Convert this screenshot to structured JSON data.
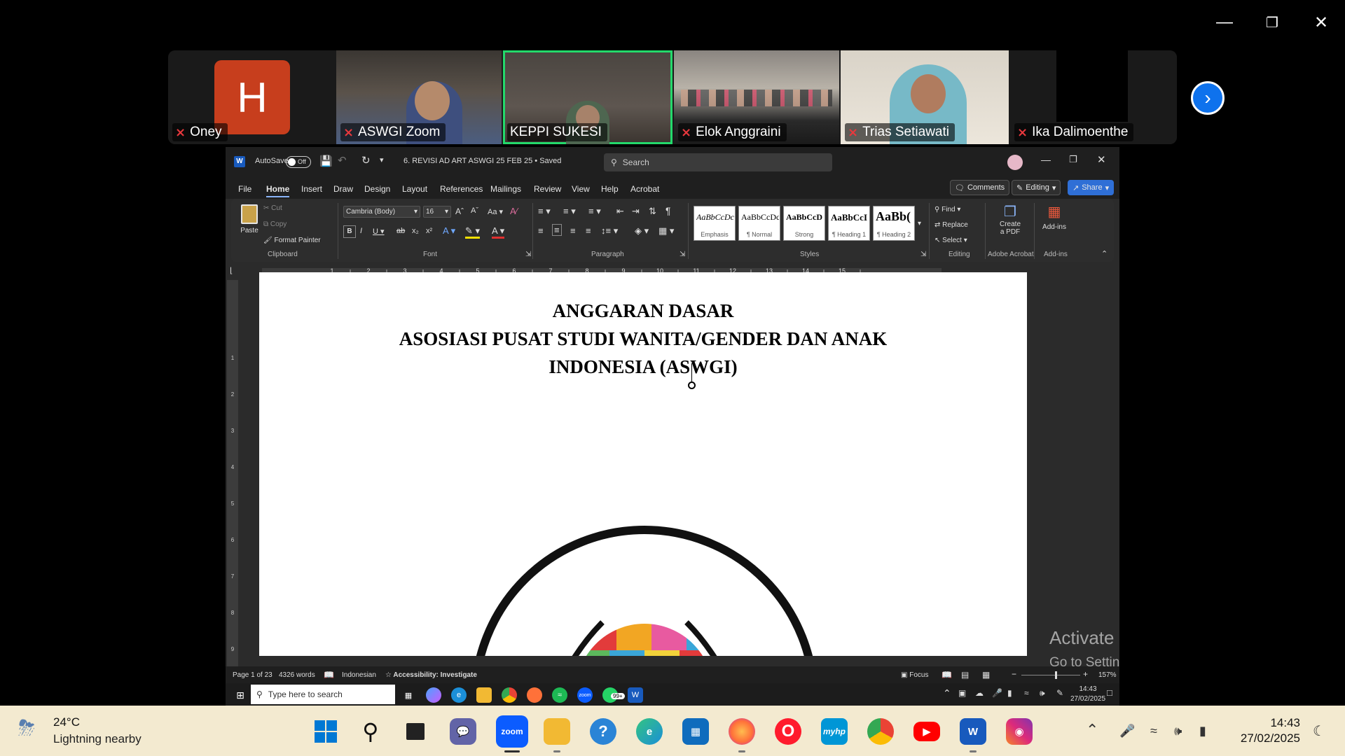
{
  "participants": [
    {
      "name": "Oney",
      "muted": true,
      "avatar_letter": "H",
      "avatar_color": "#c73e1d"
    },
    {
      "name": "ASWGI Zoom",
      "muted": true
    },
    {
      "name": "KEPPI SUKESI",
      "muted": false,
      "active_speaker": true
    },
    {
      "name": "Elok Anggraini",
      "muted": true
    },
    {
      "name": "Trias Setiawati",
      "muted": true
    },
    {
      "name": "Ika Dalimoenthe",
      "muted": true
    }
  ],
  "word": {
    "autosave_label": "AutoSave",
    "autosave_state": "Off",
    "doc_title": "6. REVISI AD ART ASWGI 25 FEB 25 • Saved",
    "search_placeholder": "Search",
    "menus": [
      "File",
      "Home",
      "Insert",
      "Draw",
      "Design",
      "Layout",
      "References",
      "Mailings",
      "Review",
      "View",
      "Help",
      "Acrobat"
    ],
    "active_menu": "Home",
    "comments_label": "Comments",
    "editing_label": "Editing",
    "share_label": "Share",
    "ribbon": {
      "paste": "Paste",
      "cut": "Cut",
      "copy": "Copy",
      "format_painter": "Format Painter",
      "clipboard": "Clipboard",
      "font_name": "Cambria (Body)",
      "font_size": "16",
      "font_group": "Font",
      "paragraph_group": "Paragraph",
      "styles": [
        {
          "preview": "AaBbCcDc",
          "name": "Emphasis"
        },
        {
          "preview": "AaBbCcDc",
          "name": "¶ Normal"
        },
        {
          "preview": "AaBbCcD",
          "name": "Strong"
        },
        {
          "preview": "AaBbCcI",
          "name": "¶ Heading 1"
        },
        {
          "preview": "AaBb(",
          "name": "¶ Heading 2"
        }
      ],
      "styles_group": "Styles",
      "find": "Find",
      "replace": "Replace",
      "select": "Select",
      "editing_group": "Editing",
      "create_pdf_line1": "Create",
      "create_pdf_line2": "a PDF",
      "acrobat_group": "Adobe Acrobat",
      "addins": "Add-ins",
      "addins_group": "Add-ins"
    },
    "ruler_numbers": [
      "1",
      "2",
      "3",
      "4",
      "5",
      "6",
      "7",
      "8",
      "9",
      "10",
      "11",
      "12",
      "13",
      "14",
      "15"
    ],
    "vruler_numbers": [
      "1",
      "2",
      "3",
      "4",
      "5",
      "6",
      "7",
      "8",
      "9"
    ],
    "document": {
      "line1": "ANGGARAN DASAR",
      "line2": "ASOSIASI PUSAT STUDI WANITA/GENDER DAN ANAK",
      "line3": "INDONESIA (ASWGI)"
    },
    "status": {
      "page": "Page 1 of 23",
      "words": "4326 words",
      "language": "Indonesian",
      "accessibility": "Accessibility: Investigate",
      "focus": "Focus",
      "zoom": "157%"
    },
    "inner_taskbar": {
      "search_placeholder": "Type here to search",
      "time": "14:43",
      "date": "27/02/2025",
      "badge": "99+"
    }
  },
  "activate_windows": {
    "title": "Activate Windows",
    "subtitle": "Go to Settings to activate Windows."
  },
  "taskbar": {
    "weather_temp": "24°C",
    "weather_desc": "Lightning nearby",
    "time": "14:43",
    "date": "27/02/2025",
    "colors": {
      "background": "#f3ead0",
      "zoom": "#0b5cff",
      "word": "#185abd",
      "youtube": "#ff0000"
    }
  }
}
